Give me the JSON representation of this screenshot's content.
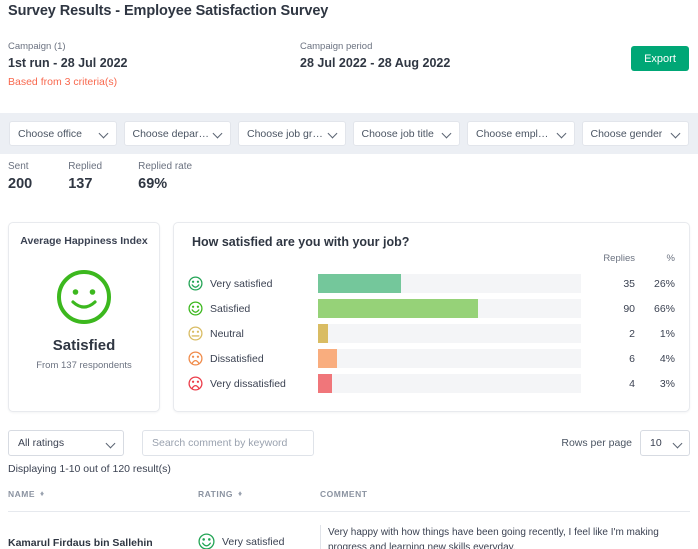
{
  "header": {
    "title": "Survey Results - Employee Satisfaction Survey",
    "campaign_label": "Campaign (1)",
    "campaign_value": "1st run - 28 Jul 2022",
    "criteria_note": "Based from 3 criteria(s)",
    "period_label": "Campaign period",
    "period_value": "28 Jul 2022 - 28 Aug 2022",
    "export_label": "Export"
  },
  "filters": [
    {
      "name": "office",
      "value": "Choose office"
    },
    {
      "name": "department",
      "value": "Choose departm..."
    },
    {
      "name": "job-grade",
      "value": "Choose job grade"
    },
    {
      "name": "job-title",
      "value": "Choose job title"
    },
    {
      "name": "employment",
      "value": "Choose employ..."
    },
    {
      "name": "gender",
      "value": "Choose gender"
    }
  ],
  "stats": [
    {
      "label": "Sent",
      "value": "200"
    },
    {
      "label": "Replied",
      "value": "137"
    },
    {
      "label": "Replied rate",
      "value": "69%"
    }
  ],
  "happiness": {
    "title": "Average Happiness Index",
    "status": "Satisfied",
    "subtitle": "From 137 respondents",
    "face_color": "#3cb81e"
  },
  "satisfaction": {
    "question": "How satisfied are you with your job?",
    "col_replies": "Replies",
    "col_percent": "%"
  },
  "chart_data": {
    "type": "bar",
    "title": "How satisfied are you with your job?",
    "xlabel": "",
    "ylabel": "",
    "orientation": "horizontal",
    "grid": false,
    "legend": false,
    "total_replies": 137,
    "categories": [
      "Very satisfied",
      "Satisfied",
      "Neutral",
      "Dissatisfied",
      "Very dissatisfied"
    ],
    "values": [
      35,
      90,
      2,
      6,
      4
    ],
    "percent_labels": [
      "26%",
      "66%",
      "1%",
      "4%",
      "3%"
    ],
    "bar_fill_ratio": [
      0.315,
      0.61,
      0.037,
      0.072,
      0.055
    ],
    "colors": [
      "#74c79b",
      "#96d278",
      "#d9bc63",
      "#f9ad7e",
      "#f0767a"
    ],
    "icon_colors": [
      "#23a455",
      "#3cb81e",
      "#d9bc63",
      "#f08b4a",
      "#ec3d4a"
    ],
    "icon_names": [
      "face-very-satisfied-icon",
      "face-satisfied-icon",
      "face-neutral-icon",
      "face-dissatisfied-icon",
      "face-very-dissatisfied-icon"
    ],
    "track_color": "#f4f5f7"
  },
  "comments": {
    "rating_filter_value": "All ratings",
    "search_placeholder": "Search comment by keyword",
    "search_value": "",
    "rows_per_page_label": "Rows per page",
    "rows_per_page_value": "10",
    "displaying": "Displaying 1-10 out of 120 result(s)",
    "columns": [
      "NAME",
      "RATING",
      "COMMENT"
    ],
    "rows": [
      {
        "name": "Kamarul Firdaus bin Sallehin",
        "rating": "Very satisfied",
        "rating_index": 0,
        "comment": "Very happy with how things have been going recently, I feel like I'm making progress and learning new skills everyday."
      }
    ]
  }
}
